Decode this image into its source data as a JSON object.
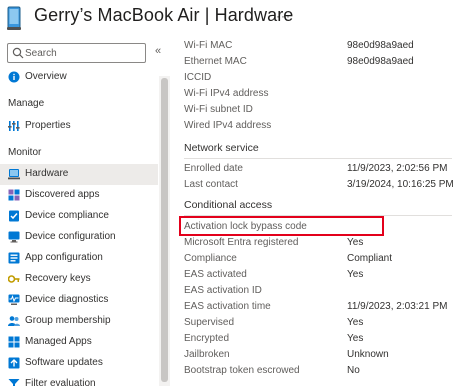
{
  "header": {
    "title": "Gerry’s MacBook Air | Hardware",
    "more": "···"
  },
  "sidebar": {
    "search_placeholder": "Search",
    "collapse": "«",
    "overview": "Overview",
    "manage_heading": "Manage",
    "properties": "Properties",
    "monitor_heading": "Monitor",
    "items": [
      {
        "label": "Hardware",
        "icon": "hardware-icon"
      },
      {
        "label": "Discovered apps",
        "icon": "discovered-apps-icon"
      },
      {
        "label": "Device compliance",
        "icon": "compliance-icon"
      },
      {
        "label": "Device configuration",
        "icon": "configuration-icon"
      },
      {
        "label": "App configuration",
        "icon": "app-config-icon"
      },
      {
        "label": "Recovery keys",
        "icon": "key-icon"
      },
      {
        "label": "Device diagnostics",
        "icon": "diagnostics-icon"
      },
      {
        "label": "Group membership",
        "icon": "group-icon"
      },
      {
        "label": "Managed Apps",
        "icon": "apps-icon"
      },
      {
        "label": "Software updates",
        "icon": "updates-icon"
      },
      {
        "label": "Filter evaluation",
        "icon": "filter-icon"
      }
    ]
  },
  "main": {
    "network_rows": [
      {
        "key": "Wi-Fi MAC",
        "value": "98e0d98a9aed"
      },
      {
        "key": "Ethernet MAC",
        "value": "98e0d98a9aed"
      },
      {
        "key": "ICCID",
        "value": ""
      },
      {
        "key": "Wi-Fi IPv4 address",
        "value": ""
      },
      {
        "key": "Wi-Fi subnet ID",
        "value": ""
      },
      {
        "key": "Wired IPv4 address",
        "value": ""
      }
    ],
    "network_service_title": "Network service",
    "network_service_rows": [
      {
        "key": "Enrolled date",
        "value": "11/9/2023, 2:02:56 PM"
      },
      {
        "key": "Last contact",
        "value": "3/19/2024, 10:16:25 PM"
      }
    ],
    "conditional_access_title": "Conditional access",
    "conditional_rows": [
      {
        "key": "Activation lock bypass code",
        "value": ""
      },
      {
        "key": "Microsoft Entra registered",
        "value": "Yes"
      },
      {
        "key": "Compliance",
        "value": "Compliant"
      },
      {
        "key": "EAS activated",
        "value": "Yes"
      },
      {
        "key": "EAS activation ID",
        "value": ""
      },
      {
        "key": "EAS activation time",
        "value": "11/9/2023, 2:03:21 PM"
      },
      {
        "key": "Supervised",
        "value": "Yes"
      },
      {
        "key": "Encrypted",
        "value": "Yes"
      },
      {
        "key": "Jailbroken",
        "value": "Unknown"
      },
      {
        "key": "Bootstrap token escrowed",
        "value": "No"
      }
    ]
  },
  "colors": {
    "highlight": "#e3001b",
    "accent": "#0078d4",
    "active_bg": "#edebe9"
  }
}
